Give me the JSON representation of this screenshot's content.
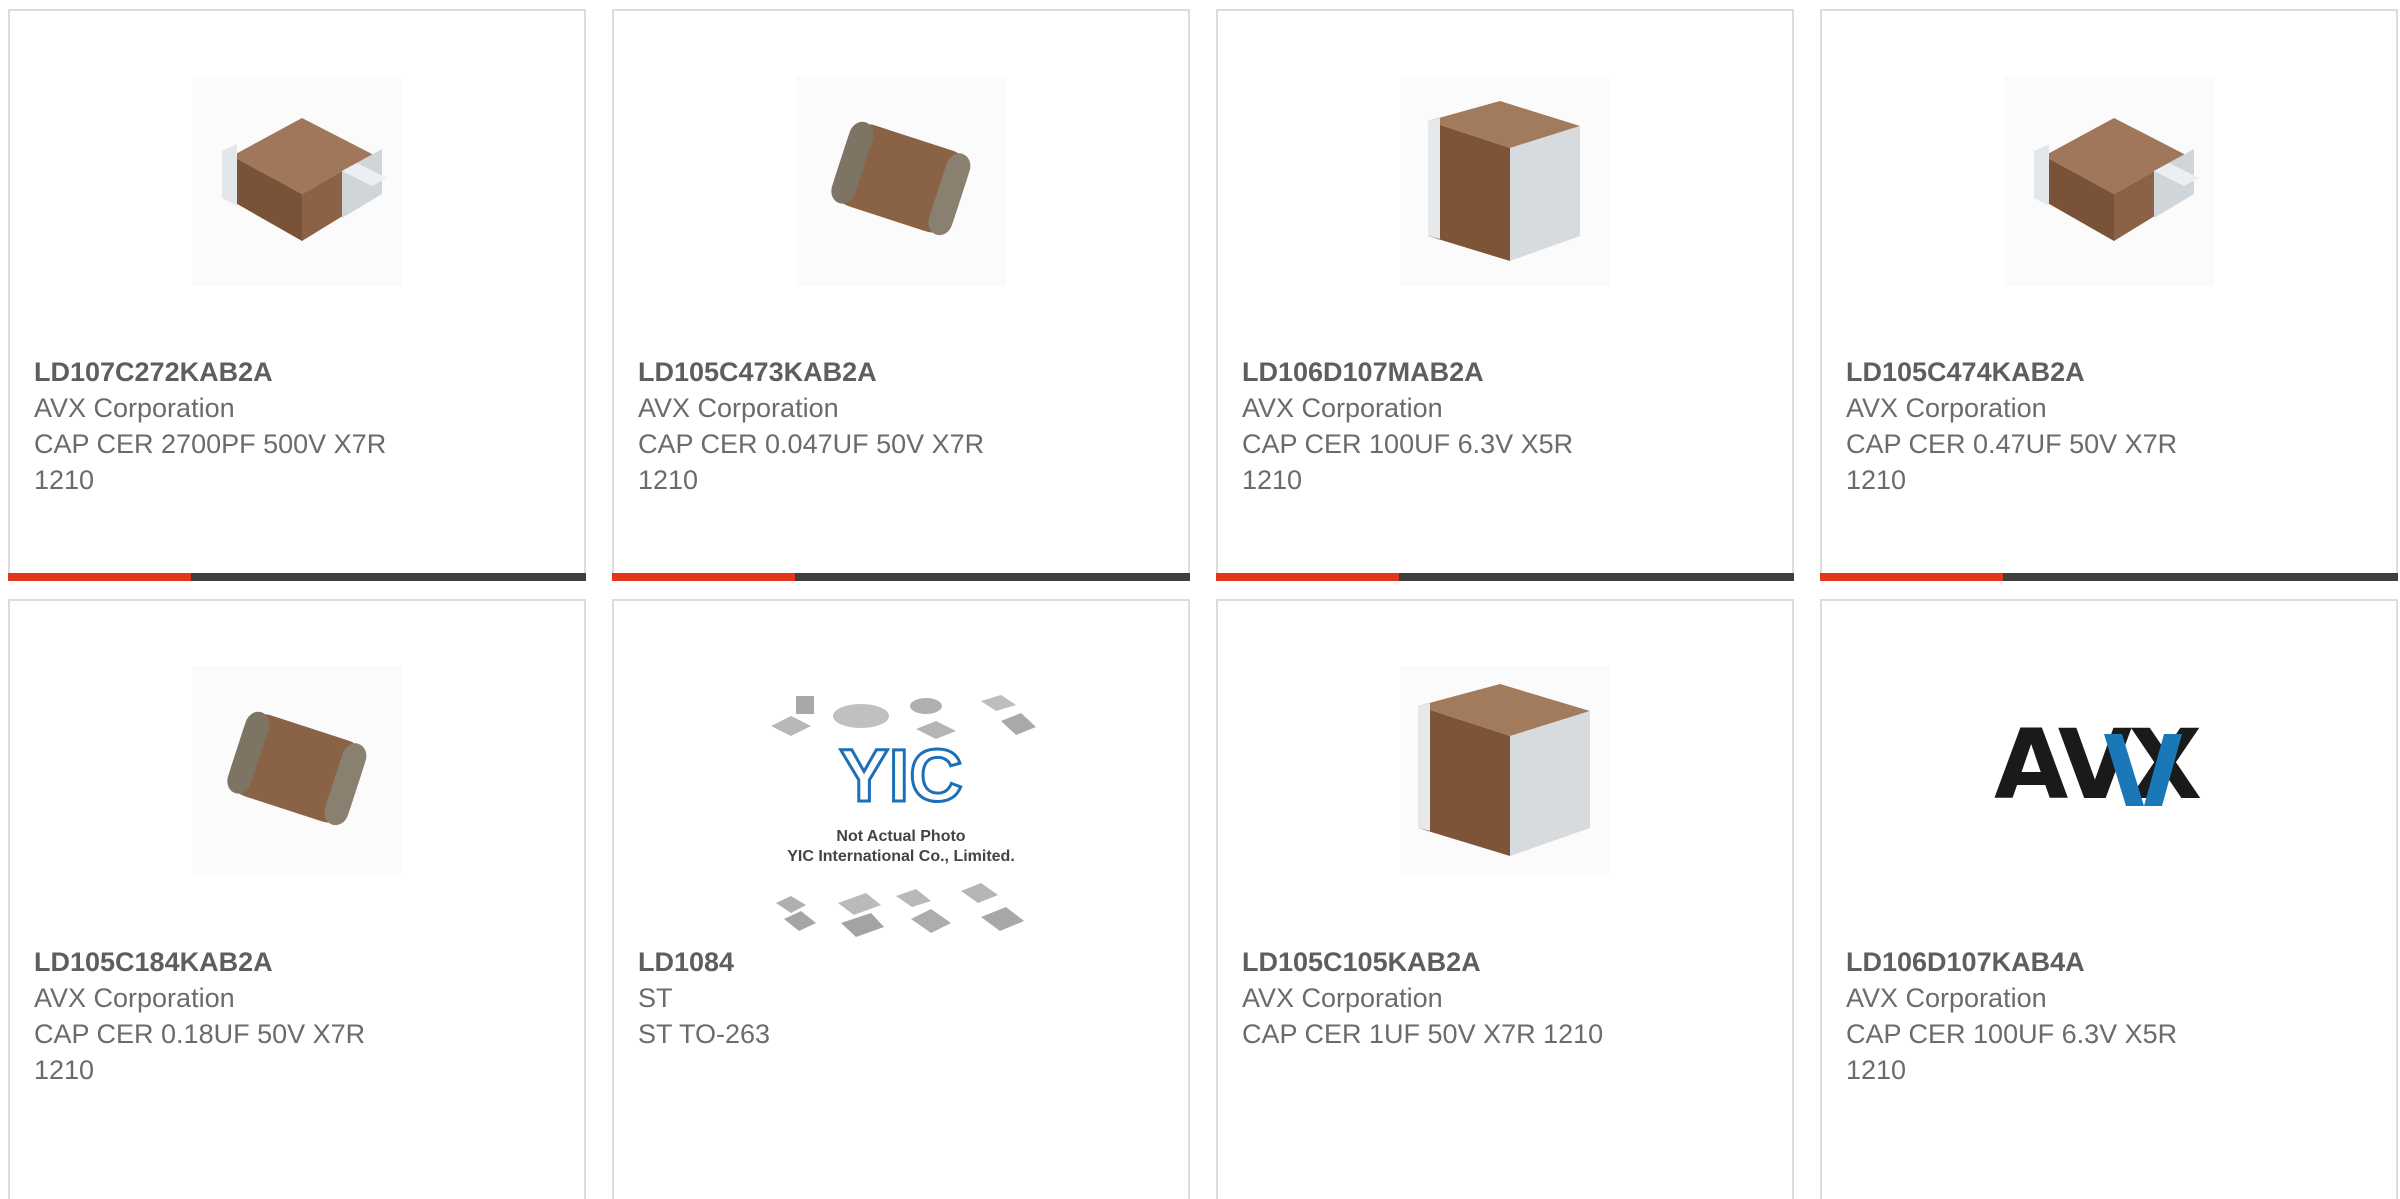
{
  "products": [
    {
      "part": "LD107C272KAB2A",
      "manufacturer": "AVX Corporation",
      "description": "CAP CER 2700PF 500V X7R 1210",
      "image": "ceramic-capacitor-block"
    },
    {
      "part": "LD105C473KAB2A",
      "manufacturer": "AVX Corporation",
      "description": "CAP CER 0.047UF 50V X7R 1210",
      "image": "ceramic-capacitor-rounded"
    },
    {
      "part": "LD106D107MAB2A",
      "manufacturer": "AVX Corporation",
      "description": "CAP CER 100UF 6.3V X5R 1210",
      "image": "ceramic-capacitor-tall"
    },
    {
      "part": "LD105C474KAB2A",
      "manufacturer": "AVX Corporation",
      "description": "CAP CER 0.47UF 50V X7R 1210",
      "image": "ceramic-capacitor-block"
    },
    {
      "part": "LD105C184KAB2A",
      "manufacturer": "AVX Corporation",
      "description": "CAP CER 0.18UF 50V X7R 1210",
      "image": "ceramic-capacitor-rounded"
    },
    {
      "part": "LD1084",
      "manufacturer": "ST",
      "description": "ST TO-263",
      "image": "placeholder-not-actual-photo"
    },
    {
      "part": "LD105C105KAB2A",
      "manufacturer": "AVX Corporation",
      "description": "CAP CER 1UF 50V X7R 1210",
      "image": "ceramic-capacitor-tall"
    },
    {
      "part": "LD106D107KAB4A",
      "manufacturer": "AVX Corporation",
      "description": "CAP CER 100UF 6.3V X5R 1210",
      "image": "avx-logo"
    }
  ],
  "placeholder": {
    "brand": "YIC",
    "line1": "Not Actual Photo",
    "line2": "YIC International Co., Limited."
  },
  "logo": {
    "text": "AVX",
    "dark_color": "#1a1a1a",
    "blue_color": "#1b78b8"
  },
  "colors": {
    "accent": "#e2361a",
    "bar": "#3f3f3f",
    "border": "#dcdcdc",
    "text": "#6b6b6b",
    "capacitor_body": "#8a6246",
    "capacitor_terminal": "#d9dde0"
  }
}
